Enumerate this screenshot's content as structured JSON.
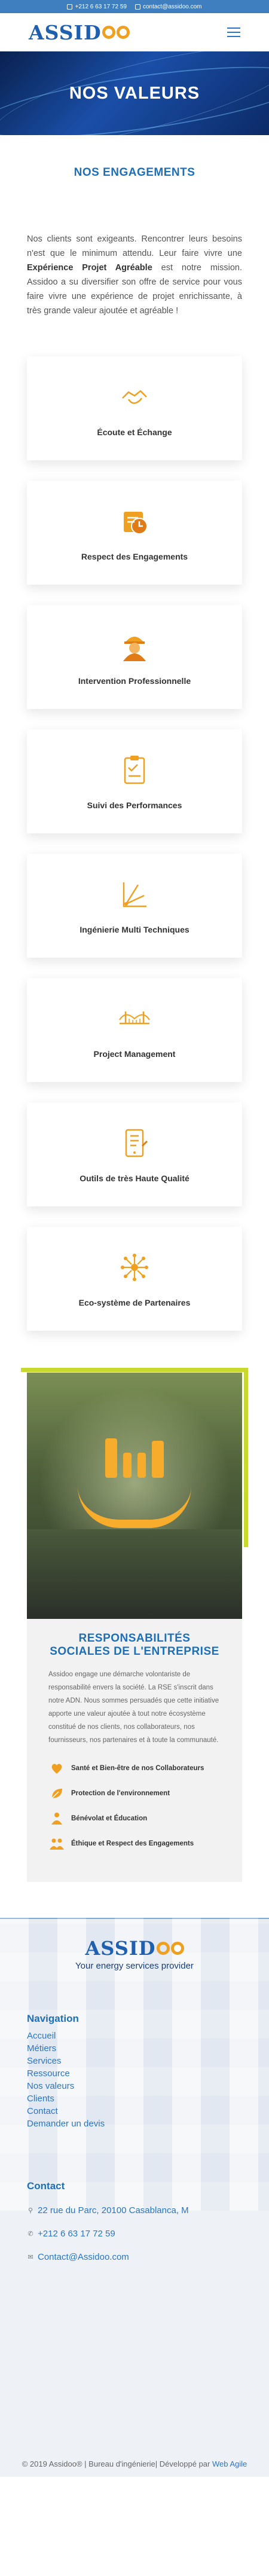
{
  "topbar": {
    "phone": "+212 6 63 17 72 59",
    "email": "contact@assidoo.com"
  },
  "brand": {
    "name": "ASSID",
    "suffix": "OO"
  },
  "hero": {
    "title": "NOS VALEURS"
  },
  "engagements": {
    "title": "NOS ENGAGEMENTS",
    "intro_1": "Nos clients sont exigeants. Rencontrer leurs besoins n'est que le minimum attendu. Leur faire vivre une ",
    "intro_bold": "Expérience Projet Agréable",
    "intro_2": " est notre mission. Assidoo a su diversifier son offre de service pour vous faire vivre une expérience de projet enrichissante, à très grande valeur ajoutée et agréable !",
    "cards": [
      {
        "label": "Écoute et Échange",
        "icon": "handshake-icon"
      },
      {
        "label": "Respect des Engagements",
        "icon": "clock-check-icon"
      },
      {
        "label": "Intervention Professionnelle",
        "icon": "engineer-icon"
      },
      {
        "label": "Suivi des Performances",
        "icon": "clipboard-icon"
      },
      {
        "label": "Ingénierie Multi Techniques",
        "icon": "drafting-icon"
      },
      {
        "label": "Project Management",
        "icon": "bridge-icon"
      },
      {
        "label": "Outils de très Haute Qualité",
        "icon": "tablet-tools-icon"
      },
      {
        "label": "Eco-système de Partenaires",
        "icon": "network-icon"
      }
    ]
  },
  "csr": {
    "title": "RESPONSABILITÉS SOCIALES DE L'ENTREPRISE",
    "text": "Assidoo engage une démarche volontariste de responsabilité envers la société. La RSE s'inscrit dans notre ADN. Nous sommes persuadés que cette initiative apporte une valeur ajoutée à tout notre écosystème constitué de nos clients, nos collaborateurs, nos fournisseurs, nos partenaires et à toute la communauté.",
    "items": [
      {
        "label": "Santé et Bien-être de nos Collaborateurs",
        "icon": "health-icon"
      },
      {
        "label": "Protection de l'environnement",
        "icon": "leaf-icon"
      },
      {
        "label": "Bénévolat et Éducation",
        "icon": "volunteer-icon"
      },
      {
        "label": "Éthique et Respect des Engagements",
        "icon": "people-icon"
      }
    ]
  },
  "footer": {
    "tagline": "Your energy services provider",
    "nav_title": "Navigation",
    "nav": [
      "Accueil",
      "Métiers",
      "Services",
      "Ressource",
      "Nos valeurs",
      "Clients",
      "Contact",
      "Demander un devis"
    ],
    "contact_title": "Contact",
    "address": "22 rue du Parc, 20100 Casablanca, M",
    "phone": "+212 6 63 17 72 59",
    "email": "Contact@Assidoo.com",
    "copyright": "© 2019 Assidoo® | Bureau d'ingénierie| Développé par",
    "credit": "Web Agile"
  },
  "colors": {
    "accent": "#1d6fb8",
    "orange": "#f0a020",
    "lime": "#c8d92e"
  }
}
